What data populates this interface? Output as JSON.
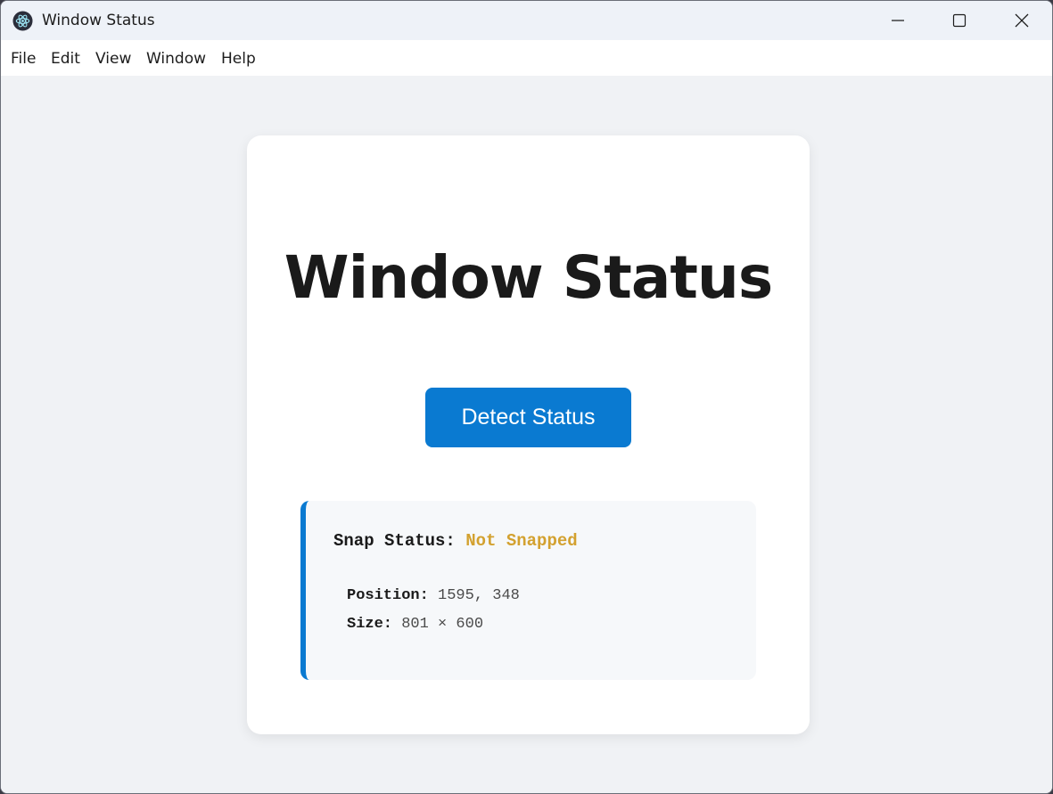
{
  "window": {
    "title": "Window Status",
    "controls": {
      "minimize": "minimize-icon",
      "maximize": "maximize-icon",
      "close": "close-icon"
    }
  },
  "menu": {
    "items": [
      "File",
      "Edit",
      "View",
      "Window",
      "Help"
    ]
  },
  "main": {
    "heading": "Window Status",
    "detect_button_label": "Detect Status",
    "status": {
      "snap_label": "Snap Status:",
      "snap_value": "Not Snapped",
      "position_label": "Position:",
      "position_value": "1595, 348",
      "size_label": "Size:",
      "size_value": "801 × 600"
    }
  },
  "colors": {
    "accent": "#0a7ad1",
    "snap_value": "#d3a12f",
    "page_bg": "#f0f2f5",
    "card_bg": "#ffffff",
    "panel_bg": "#f6f8fa"
  }
}
